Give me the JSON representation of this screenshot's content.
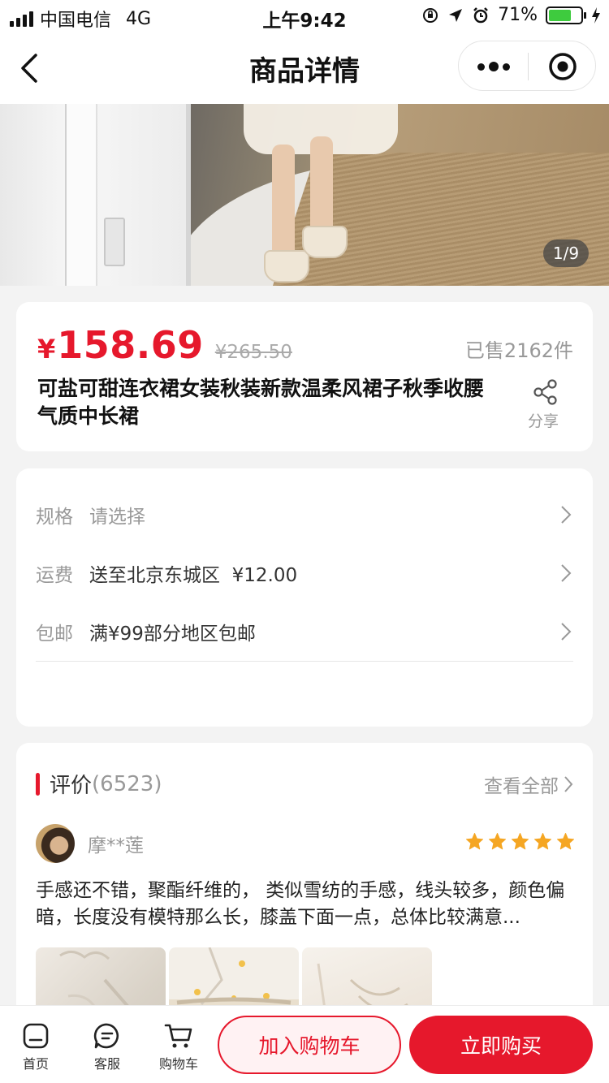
{
  "status_bar": {
    "carrier": "中国电信",
    "network": "4G",
    "time": "上午9:42",
    "battery": "71%",
    "battery_level": 0.71
  },
  "nav": {
    "title": "商品详情"
  },
  "gallery": {
    "counter": "1/9"
  },
  "product": {
    "currency": "¥",
    "price": "158.69",
    "original_price": "¥265.50",
    "sold": "已售2162件",
    "title": "可盐可甜连衣裙女装秋装新款温柔风裙子秋季收腰气质中长裙",
    "share_label": "分享"
  },
  "specs": [
    {
      "key": "规格",
      "value": "请选择"
    },
    {
      "key": "运费",
      "value": "送至北京东城区  ¥12.00"
    },
    {
      "key": "包邮",
      "value": "满¥99部分地区包邮"
    }
  ],
  "reviews": {
    "title": "评价",
    "count": "(6523)",
    "view_all": "查看全部",
    "items": [
      {
        "name": "摩**莲",
        "rating": 5,
        "text": "手感还不错，聚酯纤维的， 类似雪纺的手感，线头较多，颜色偏暗，长度没有模特那么长，膝盖下面一点，总体比较满意..."
      }
    ]
  },
  "bottom_bar": {
    "home": "首页",
    "service": "客服",
    "cart": "购物车",
    "add_to_cart": "加入购物车",
    "buy_now": "立即购买"
  },
  "colors": {
    "accent": "#e6182c",
    "star": "#f5a623"
  }
}
